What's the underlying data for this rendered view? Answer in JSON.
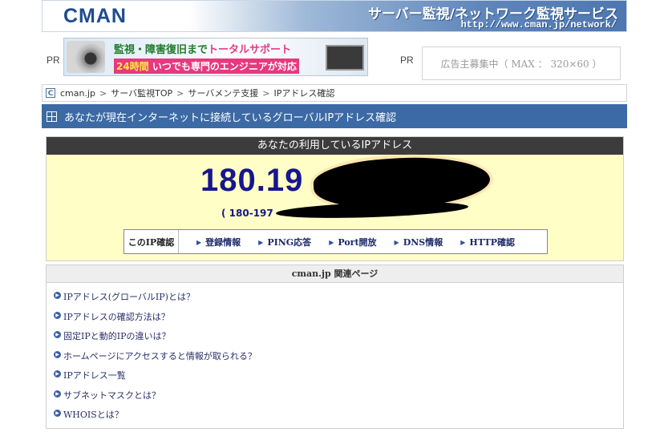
{
  "header": {
    "logo": "CMAN",
    "tagline": "サーバー監視/ネットワーク監視サービス",
    "url": "http://www.cman.jp/network/"
  },
  "ads": {
    "pr_label": "PR",
    "banner": {
      "line1_a": "監視・障害復旧まで",
      "line1_b": "トータルサポート",
      "line2_a": "24時間",
      "line2_b": "いつでも専門のエンジニアが対応"
    },
    "placeholder": "広告主募集中（ MAX ： 320×60 ）"
  },
  "breadcrumb": {
    "icon": "C",
    "items": [
      "cman.jp",
      "サーバ監視TOP",
      "サーバメンテ支援",
      "IPアドレス確認"
    ]
  },
  "page_title": "あなたが現在インターネットに接続しているグローバルIPアドレス確認",
  "ip_section": {
    "heading": "あなたの利用しているIPアドレス",
    "ip_visible": "180.19",
    "host_visible": "( 180-197",
    "check_label": "このIP確認",
    "links": [
      "登録情報",
      "PING応答",
      "Port開放",
      "DNS情報",
      "HTTP確認"
    ]
  },
  "related": {
    "heading": "cman.jp 関連ページ",
    "items": [
      "IPアドレス(グローバルIP)とは？",
      "IPアドレスの確認方法は？",
      "固定IPと動的IPの違いは？",
      "ホームページにアクセスすると情報が取られる？",
      "IPアドレス一覧",
      "サブネットマスクとは？",
      "WHOISとは？"
    ]
  }
}
